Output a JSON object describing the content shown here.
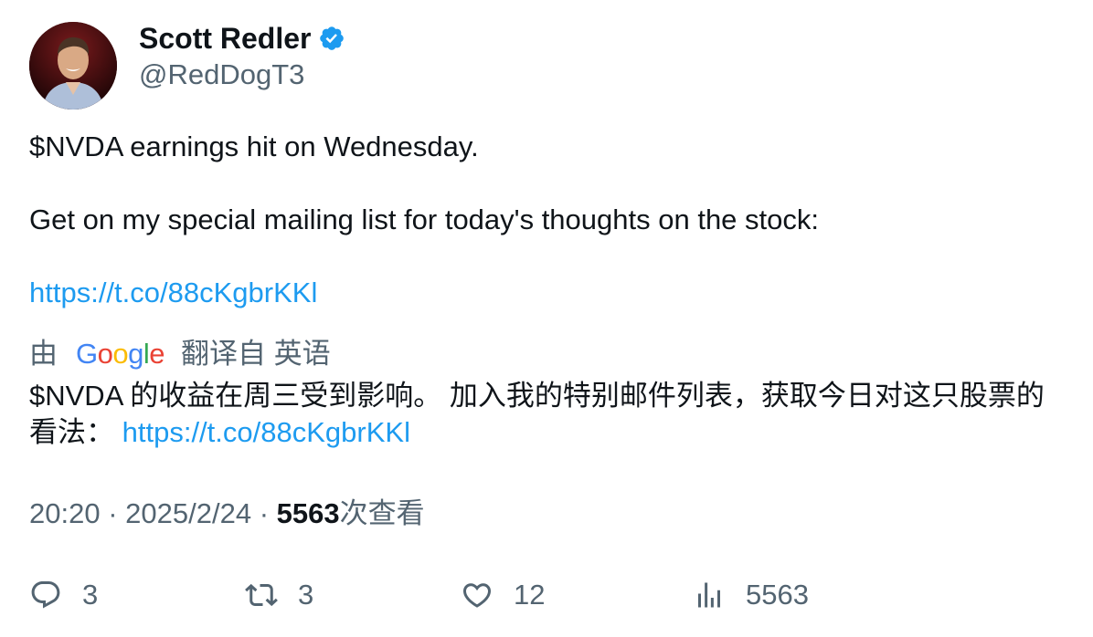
{
  "author": {
    "name": "Scott Redler",
    "handle": "@RedDogT3"
  },
  "tweet": {
    "line1": "$NVDA earnings hit on Wednesday.",
    "line2": "Get on my special mailing list for today's thoughts on the stock:",
    "link": "https://t.co/88cKgbrKKl"
  },
  "translation": {
    "prefix": "由",
    "provider_letters": [
      "G",
      "o",
      "o",
      "g",
      "l",
      "e"
    ],
    "suffix": "翻译自 英语",
    "text": "$NVDA 的收益在周三受到影响。 加入我的特别邮件列表，获取今日对这只股票的看法：",
    "link": "https://t.co/88cKgbrKKl"
  },
  "meta": {
    "time": "20:20",
    "separator": "·",
    "date": "2025/2/24",
    "views_count": "5563",
    "views_label": "次查看"
  },
  "actions": {
    "replies": "3",
    "reposts": "3",
    "likes": "12",
    "views": "5563"
  },
  "icons": [
    "verified-badge-icon",
    "reply-icon",
    "repost-icon",
    "like-icon",
    "views-icon"
  ],
  "colors": {
    "link": "#1d9bf0",
    "secondary_text": "#536471",
    "verified": "#1d9bf0"
  }
}
